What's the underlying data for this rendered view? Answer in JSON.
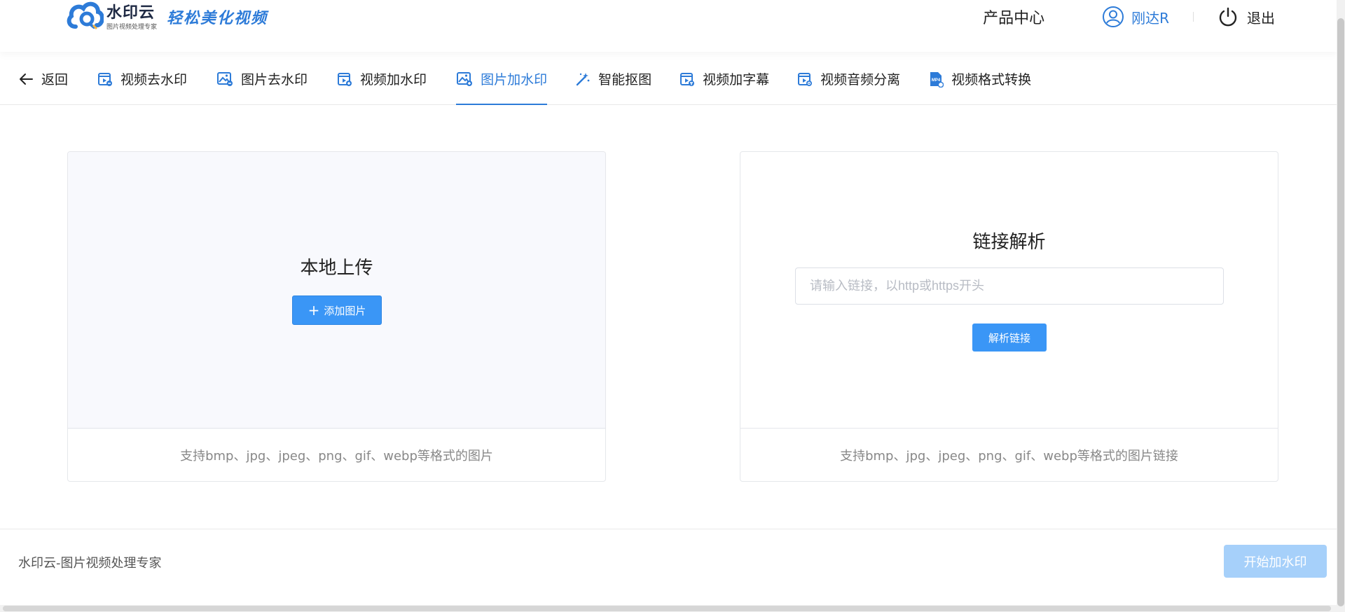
{
  "header": {
    "logo": {
      "brand": "水印云",
      "subtitle": "图片视频处理专家",
      "slogan": "轻松美化视频",
      "icon": "cloud-logo-icon",
      "color": "#2d7bd8"
    },
    "product_center": "产品中心",
    "user": {
      "name": "刚达R",
      "icon": "user-icon"
    },
    "separator": "|",
    "logout": {
      "label": "退出",
      "icon": "power-icon"
    }
  },
  "tabs": [
    {
      "label": "返回",
      "icon": "arrow-left-icon",
      "active": false
    },
    {
      "label": "视频去水印",
      "icon": "video-icon",
      "active": false
    },
    {
      "label": "图片去水印",
      "icon": "image-icon",
      "active": false
    },
    {
      "label": "视频加水印",
      "icon": "video-add-icon",
      "active": false
    },
    {
      "label": "图片加水印",
      "icon": "image-add-icon",
      "active": true
    },
    {
      "label": "智能抠图",
      "icon": "magic-wand-icon",
      "active": false
    },
    {
      "label": "视频加字幕",
      "icon": "video-subtitle-icon",
      "active": false
    },
    {
      "label": "视频音频分离",
      "icon": "video-audio-icon",
      "active": false
    },
    {
      "label": "视频格式转换",
      "icon": "mp4-file-icon",
      "active": false
    }
  ],
  "upload_panel": {
    "title": "本地上传",
    "button_label": "添加图片",
    "button_icon": "plus-icon",
    "note": "支持bmp、jpg、jpeg、png、gif、webp等格式的图片"
  },
  "link_panel": {
    "title": "链接解析",
    "input_value": "",
    "input_placeholder": "请输入链接，以http或https开头",
    "button_label": "解析链接",
    "note": "支持bmp、jpg、jpeg、png、gif、webp等格式的图片链接"
  },
  "footer": {
    "text": "水印云-图片视频处理专家",
    "start_button": "开始加水印",
    "start_button_state": "disabled"
  },
  "colors": {
    "accent": "#2d7bd8",
    "button": "#3a96f6",
    "button_disabled": "#a6d0fa"
  }
}
